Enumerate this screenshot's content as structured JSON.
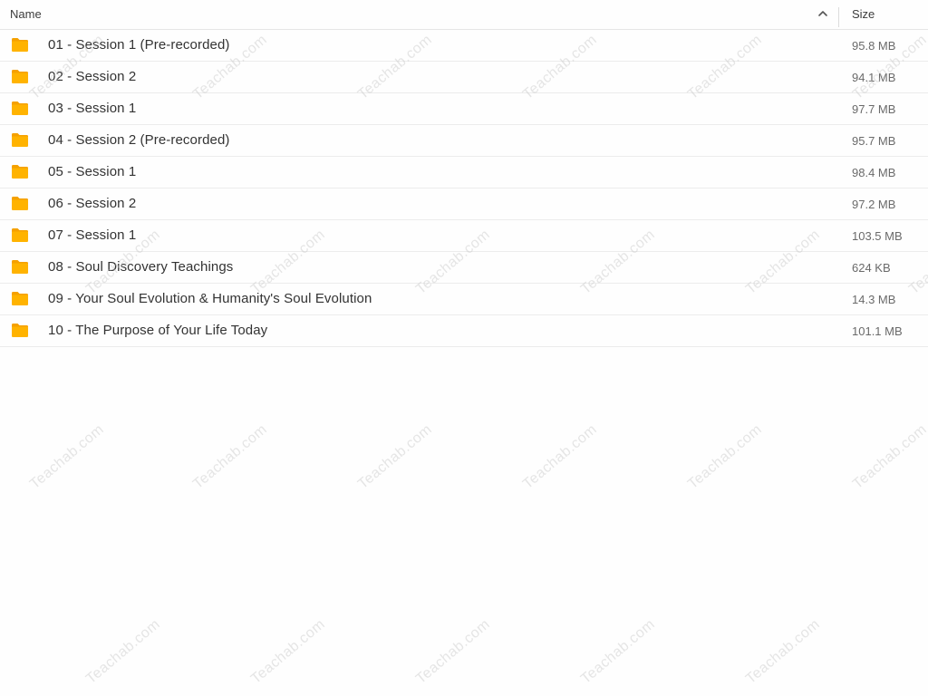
{
  "header": {
    "name_label": "Name",
    "size_label": "Size",
    "sort_icon": "chevron-up-icon"
  },
  "rows": [
    {
      "name": "01 - Session 1 (Pre-recorded)",
      "size": "95.8 MB",
      "icon": "folder-icon"
    },
    {
      "name": "02 - Session 2",
      "size": "94.1 MB",
      "icon": "folder-icon"
    },
    {
      "name": "03 - Session 1",
      "size": "97.7 MB",
      "icon": "folder-icon"
    },
    {
      "name": "04 - Session 2 (Pre-recorded)",
      "size": "95.7 MB",
      "icon": "folder-icon"
    },
    {
      "name": "05 - Session 1",
      "size": "98.4 MB",
      "icon": "folder-icon"
    },
    {
      "name": "06 - Session 2",
      "size": "97.2 MB",
      "icon": "folder-icon"
    },
    {
      "name": "07 - Session 1",
      "size": "103.5 MB",
      "icon": "folder-icon"
    },
    {
      "name": "08 - Soul Discovery Teachings",
      "size": "624 KB",
      "icon": "folder-icon"
    },
    {
      "name": "09 - Your Soul Evolution & Humanity's Soul Evolution",
      "size": "14.3 MB",
      "icon": "folder-icon"
    },
    {
      "name": "10 - The Purpose of Your Life Today",
      "size": "101.1 MB",
      "icon": "folder-icon"
    }
  ],
  "watermark": "Teachab.com",
  "colors": {
    "folder": "#ffb300",
    "folder_tab": "#f5a100",
    "background": "#fefefe",
    "divider": "#ececec"
  }
}
